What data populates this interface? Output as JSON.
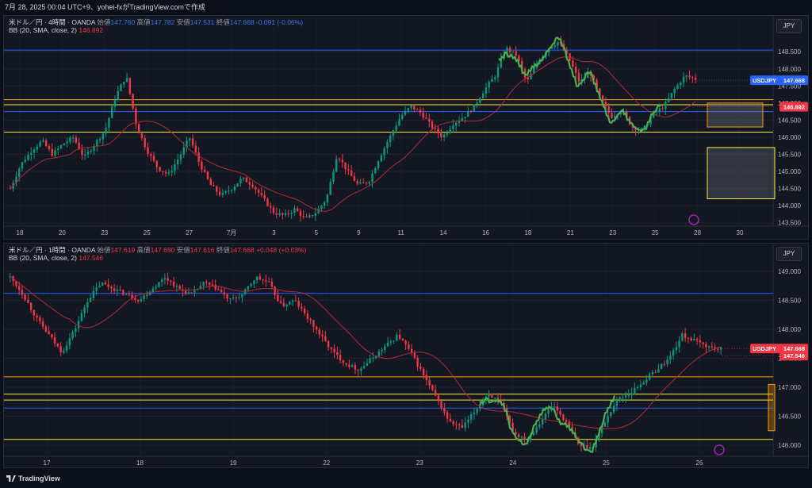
{
  "header": "7月 28, 2025 00:04 UTC+9、yohei-fxがTradingView.comで作成",
  "footer_logo": "TradingView",
  "colors": {
    "up": "#089981",
    "down": "#f23645",
    "wave": "#4caf50",
    "bb": "#b02b35"
  },
  "panels": [
    {
      "currency": "JPY",
      "legend": {
        "symbol": "米ドル／円 · 4時間 · OANDA",
        "o_lab": "始値",
        "o": "147.760",
        "h_lab": "高値",
        "h": "147.782",
        "l_lab": "安値",
        "l": "147.531",
        "c_lab": "終値",
        "c": "147.668",
        "chg": "-0.091 (-0.06%)"
      },
      "bb_legend": {
        "label": "BB (20, SMA, close, 2)",
        "value": "146.892"
      },
      "price_labels": [
        "148.500",
        "148.000",
        "147.500",
        "147.000",
        "146.500",
        "146.000",
        "145.500",
        "145.000",
        "144.500",
        "144.000",
        "143.500"
      ],
      "time_labels": [
        "18",
        "20",
        "23",
        "25",
        "27",
        "7月",
        "3",
        "5",
        "9",
        "11",
        "14",
        "16",
        "18",
        "21",
        "23",
        "25",
        "28",
        "30"
      ],
      "badges": [
        {
          "text": "USDJPY",
          "value": "147.668",
          "color": "#2962ff"
        },
        {
          "text": "",
          "value": "146.892",
          "color": "#f23645"
        }
      ]
    },
    {
      "currency": "JPY",
      "legend": {
        "symbol": "米ドル／円 · 1時間 · OANDA",
        "o_lab": "始値",
        "o": "147.619",
        "h_lab": "高値",
        "h": "147.690",
        "l_lab": "安値",
        "l": "147.616",
        "c_lab": "終値",
        "c": "147.668",
        "chg": "+0.048 (+0.03%)"
      },
      "bb_legend": {
        "label": "BB (20, SMA, close, 2)",
        "value": "147.546"
      },
      "price_labels": [
        "149.000",
        "148.500",
        "148.000",
        "147.500",
        "147.000",
        "146.500",
        "146.000"
      ],
      "time_labels": [
        "17",
        "18",
        "19",
        "22",
        "23",
        "24",
        "25",
        "26"
      ],
      "badges": [
        {
          "text": "USDJPY",
          "value": "147.668",
          "color": "#f23645"
        },
        {
          "text": "",
          "value": "147.546",
          "color": "#f23645"
        }
      ]
    }
  ],
  "chart_data": [
    {
      "type": "candlestick",
      "title": "米ドル／円 · 4時間 · OANDA",
      "ylim": [
        143.4,
        148.9
      ],
      "x_ticks": [
        "18",
        "20",
        "23",
        "25",
        "27",
        "7月",
        "3",
        "5",
        "9",
        "11",
        "14",
        "16",
        "18",
        "21",
        "23",
        "25",
        "28",
        "30"
      ],
      "close_path": [
        144.5,
        145.2,
        145.6,
        145.9,
        145.5,
        145.8,
        146.0,
        145.4,
        145.8,
        146.2,
        147.2,
        147.8,
        146.3,
        145.6,
        145.1,
        144.9,
        145.4,
        146.0,
        145.2,
        144.6,
        144.3,
        144.5,
        144.8,
        144.6,
        144.2,
        143.8,
        143.7,
        143.9,
        143.6,
        143.8,
        144.2,
        145.5,
        145.0,
        144.6,
        144.7,
        145.4,
        146.0,
        146.6,
        146.9,
        146.7,
        146.3,
        146.0,
        146.4,
        146.6,
        146.9,
        147.4,
        147.8,
        148.6,
        148.4,
        147.6,
        148.2,
        148.6,
        148.8,
        148.3,
        147.6,
        147.9,
        147.1,
        146.6,
        146.8,
        146.3,
        146.2,
        146.7,
        146.9,
        147.4,
        147.8,
        147.7
      ],
      "horizontal_levels": [
        {
          "value": 148.55,
          "color": "#2962ff"
        },
        {
          "value": 147.1,
          "color": "#ff9800"
        },
        {
          "value": 146.95,
          "color": "#ffeb3b"
        },
        {
          "value": 146.75,
          "color": "#2962ff"
        },
        {
          "value": 146.15,
          "color": "#ffeb3b"
        }
      ]
    },
    {
      "type": "candlestick",
      "title": "米ドル／円 · 1時間 · OANDA",
      "ylim": [
        145.85,
        149.15
      ],
      "x_ticks": [
        "17",
        "18",
        "19",
        "22",
        "23",
        "24",
        "25",
        "26"
      ],
      "close_path": [
        148.9,
        148.6,
        148.2,
        147.9,
        147.6,
        148.0,
        148.5,
        148.8,
        148.7,
        148.6,
        148.5,
        148.7,
        148.9,
        148.7,
        148.6,
        148.8,
        148.7,
        148.5,
        148.6,
        148.9,
        148.8,
        148.4,
        148.5,
        148.2,
        147.9,
        147.6,
        147.4,
        147.3,
        147.5,
        147.7,
        147.9,
        147.6,
        147.2,
        146.8,
        146.4,
        146.3,
        146.6,
        146.9,
        146.7,
        146.2,
        146.1,
        146.4,
        146.7,
        146.4,
        146.0,
        145.95,
        146.4,
        146.8,
        146.9,
        147.1,
        147.3,
        147.5,
        147.9,
        147.8,
        147.7,
        147.65
      ],
      "horizontal_levels": [
        {
          "value": 148.62,
          "color": "#2962ff"
        },
        {
          "value": 147.18,
          "color": "#ff9800"
        },
        {
          "value": 146.88,
          "color": "#ffeb3b"
        },
        {
          "value": 146.78,
          "color": "#ffeb3b"
        },
        {
          "value": 146.64,
          "color": "#2962ff"
        },
        {
          "value": 146.1,
          "color": "#ffeb3b"
        }
      ]
    }
  ]
}
